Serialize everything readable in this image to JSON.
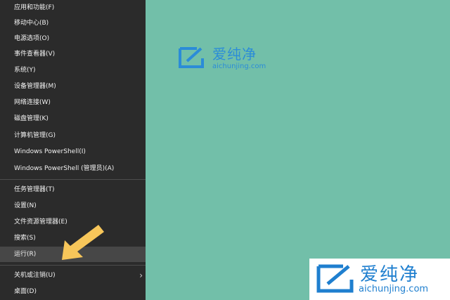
{
  "menu": {
    "items": [
      {
        "label": "应用和功能(F)"
      },
      {
        "label": "移动中心(B)"
      },
      {
        "label": "电源选项(O)"
      },
      {
        "label": "事件查看器(V)"
      },
      {
        "label": "系统(Y)"
      },
      {
        "label": "设备管理器(M)"
      },
      {
        "label": "网络连接(W)"
      },
      {
        "label": "磁盘管理(K)"
      },
      {
        "label": "计算机管理(G)"
      },
      {
        "label": "Windows PowerShell(I)"
      },
      {
        "label": "Windows PowerShell (管理员)(A)"
      },
      {
        "label": "任务管理器(T)"
      },
      {
        "label": "设置(N)"
      },
      {
        "label": "文件资源管理器(E)"
      },
      {
        "label": "搜索(S)"
      },
      {
        "label": "运行(R)"
      },
      {
        "label": "关机或注销(U)",
        "chevron": "›"
      },
      {
        "label": "桌面(D)"
      }
    ]
  },
  "watermark": {
    "brand_cn": "爱纯净",
    "brand_url": "aichunjing.com"
  },
  "colors": {
    "desktop": "#72bfa9",
    "menu_bg": "#2b2b2b",
    "highlight": "#474747",
    "arrow": "#f7c65a",
    "brand_blue": "#2b8cd8"
  },
  "icons": [
    "chevron-right-icon",
    "pointer-arrow-icon",
    "brand-logo-icon"
  ]
}
